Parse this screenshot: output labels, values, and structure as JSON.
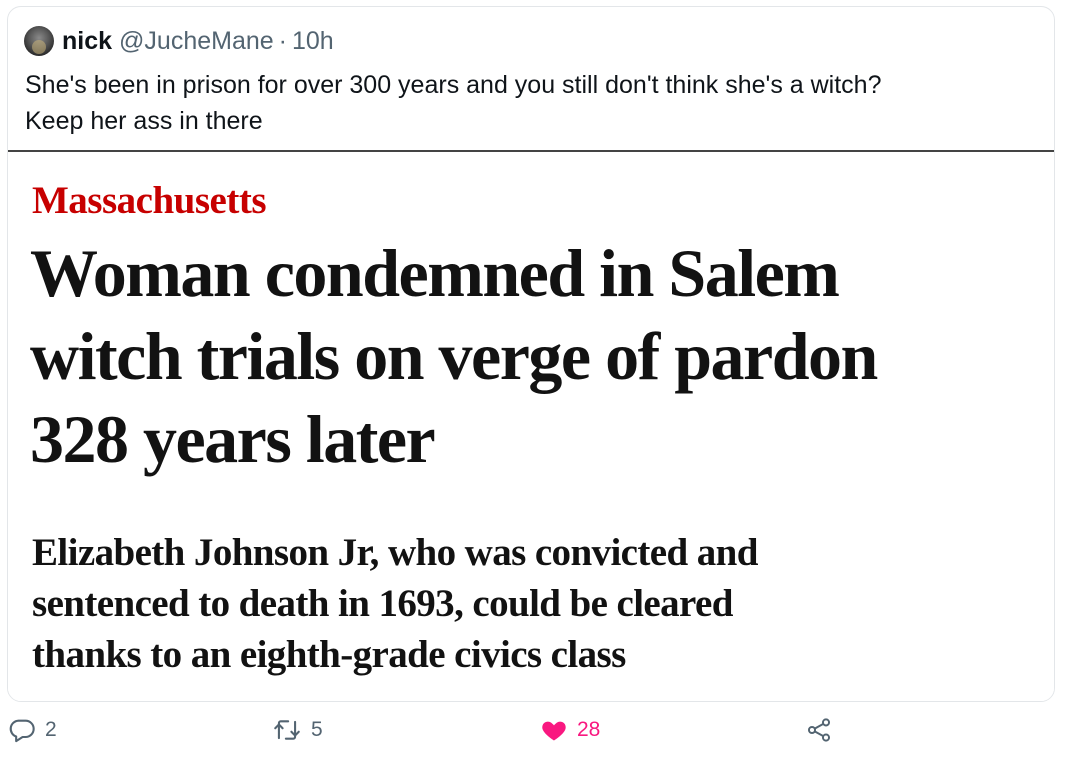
{
  "tweet": {
    "author": {
      "display_name": "nick",
      "handle": "@JucheMane",
      "separator": "·",
      "time": "10h"
    },
    "text_lines": [
      "She's been in prison for over 300 years and you still don't think she's a witch?",
      "Keep her ass in there"
    ]
  },
  "article": {
    "section": "Massachusetts",
    "headline_lines": [
      "Woman condemned in Salem",
      "witch trials on verge of pardon",
      "328 years later"
    ],
    "standfirst_lines": [
      "Elizabeth Johnson Jr, who was convicted and",
      "sentenced to death in 1693, could be cleared",
      "thanks to an eighth-grade civics class"
    ],
    "colors": {
      "section": "#c70000",
      "text": "#121212"
    }
  },
  "actions": {
    "reply": {
      "icon": "reply-icon",
      "count": "2"
    },
    "retweet": {
      "icon": "retweet-icon",
      "count": "5"
    },
    "like": {
      "icon": "heart-icon",
      "count": "28",
      "liked": true,
      "color": "#f91880"
    },
    "share": {
      "icon": "share-icon",
      "count": ""
    }
  }
}
